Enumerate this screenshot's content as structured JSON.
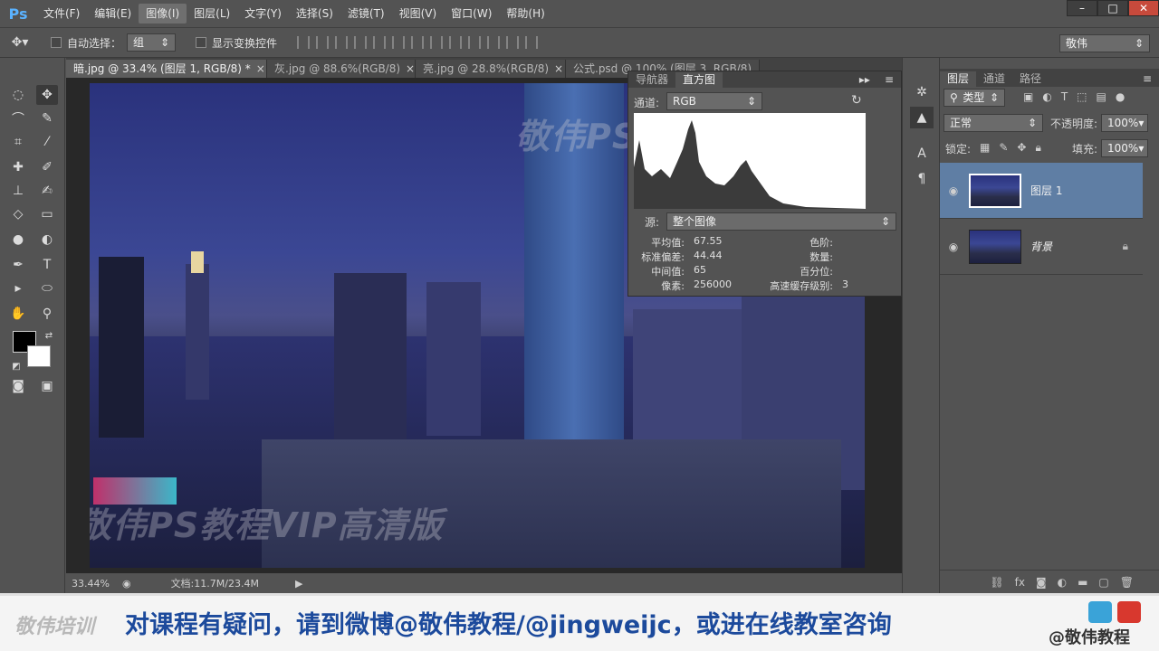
{
  "app": {
    "logo": "Ps"
  },
  "menu": [
    "文件(F)",
    "编辑(E)",
    "图像(I)",
    "图层(L)",
    "文字(Y)",
    "选择(S)",
    "滤镜(T)",
    "视图(V)",
    "窗口(W)",
    "帮助(H)"
  ],
  "window_controls": [
    "–",
    "□",
    "✕"
  ],
  "options": {
    "auto_select_label": "自动选择：",
    "auto_select_value": "组",
    "show_transform_label": "显示变换控件",
    "workspace": "敬伟"
  },
  "tabs": [
    {
      "label": "暗.jpg @ 33.4% (图层 1, RGB/8) *",
      "close": "×"
    },
    {
      "label": "灰.jpg @ 88.6%(RGB/8)",
      "close": "×"
    },
    {
      "label": "亮.jpg @ 28.8%(RGB/8)",
      "close": "×"
    },
    {
      "label": "公式.psd @ 100% (图层 3, RGB/8)",
      "close": "×"
    }
  ],
  "status": {
    "zoom": "33.44%",
    "doc": "文档:11.7M/23.4M"
  },
  "watermarks": [
    "敬伟PS教程VIP高清版",
    "敬伟PS教程VIP高清版"
  ],
  "histogram": {
    "tabs": [
      "导航器",
      "直方图"
    ],
    "channel_label": "通道:",
    "channel_value": "RGB",
    "source_label": "源:",
    "source_value": "整个图像",
    "stats_left": [
      {
        "label": "平均值:",
        "value": "67.55"
      },
      {
        "label": "标准偏差:",
        "value": "44.44"
      },
      {
        "label": "中间值:",
        "value": "65"
      },
      {
        "label": "像素:",
        "value": "256000"
      }
    ],
    "stats_right": [
      {
        "label": "色阶:",
        "value": ""
      },
      {
        "label": "数量:",
        "value": ""
      },
      {
        "label": "百分位:",
        "value": ""
      },
      {
        "label": "高速缓存级别:",
        "value": "3"
      }
    ]
  },
  "layers_panel": {
    "tabs": [
      "图层",
      "通道",
      "路径"
    ],
    "filter_label": "类型",
    "blend_mode": "正常",
    "opacity_label": "不透明度:",
    "opacity_value": "100%",
    "lock_label": "锁定:",
    "fill_label": "填充:",
    "fill_value": "100%",
    "layers": [
      {
        "name": "图层 1",
        "selected": true
      },
      {
        "name": "背景",
        "selected": false
      }
    ]
  },
  "banner": {
    "brand": "敬伟培训",
    "text": "对课程有疑问，请到微博@敬伟教程/@jingweijc，或进在线教室咨询",
    "handle": "@敬伟教程"
  }
}
